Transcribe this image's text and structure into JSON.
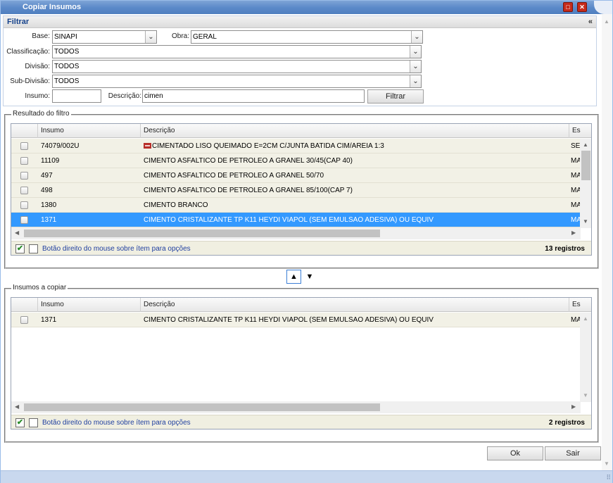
{
  "window": {
    "title": "Copiar Insumos",
    "maximize_icon": "maximize-icon",
    "close_icon": "close-icon"
  },
  "filter_panel": {
    "title": "Filtrar",
    "collapse_label": "«",
    "base_label": "Base:",
    "base_value": "SINAPI",
    "obra_label": "Obra:",
    "obra_value": "GERAL",
    "classificacao_label": "Classificação:",
    "classificacao_value": "TODOS",
    "divisao_label": "Divisão:",
    "divisao_value": "TODOS",
    "subdivisao_label": "Sub-Divisão:",
    "subdivisao_value": "TODOS",
    "insumo_label": "Insumo:",
    "insumo_value": "",
    "descricao_label": "Descrição:",
    "descricao_value": "cimen",
    "filter_button": "Filtrar"
  },
  "result_grid": {
    "legend": "Resultado do filtro",
    "columns": [
      "Insumo",
      "Descrição",
      "Es"
    ],
    "rows": [
      {
        "insumo": "74079/002U",
        "descricao": "CIMENTADO LISO QUEIMADO E=2CM C/JUNTA BATIDA CIM/AREIA 1:3",
        "es": "SE"
      },
      {
        "insumo": "11109",
        "descricao": "CIMENTO ASFALTICO DE PETROLEO A GRANEL 30/45(CAP 40)",
        "es": "MA"
      },
      {
        "insumo": "497",
        "descricao": "CIMENTO ASFALTICO DE PETROLEO A GRANEL 50/70",
        "es": "MA"
      },
      {
        "insumo": "498",
        "descricao": "CIMENTO ASFALTICO DE PETROLEO A GRANEL 85/100(CAP 7)",
        "es": "MA"
      },
      {
        "insumo": "1380",
        "descricao": "CIMENTO BRANCO",
        "es": "MA"
      },
      {
        "insumo": "1371",
        "descricao": "CIMENTO CRISTALIZANTE TP K11 HEYDI VIAPOL (SEM EMULSAO ADESIVA) OU EQUIV",
        "es": "MA"
      }
    ],
    "hint": "Botão direito do mouse sobre ítem para opções",
    "count": "13 registros"
  },
  "copy_grid": {
    "legend": "Insumos a copiar",
    "columns": [
      "Insumo",
      "Descrição",
      "Es"
    ],
    "rows": [
      {
        "insumo": "1371",
        "descricao": "CIMENTO CRISTALIZANTE TP K11 HEYDI VIAPOL (SEM EMULSAO ADESIVA) OU EQUIV",
        "es": "MA"
      }
    ],
    "hint": "Botão direito do mouse sobre ítem para opções",
    "count": "2 registros"
  },
  "mover": {
    "up_icon": "arrow-up-icon",
    "down_icon": "arrow-down-icon"
  },
  "actions": {
    "ok": "Ok",
    "exit": "Sair"
  },
  "colors": {
    "selected_row": "#3399ff",
    "row_bg": "#f2f1e6",
    "title_bar": "#5c8ac9"
  }
}
